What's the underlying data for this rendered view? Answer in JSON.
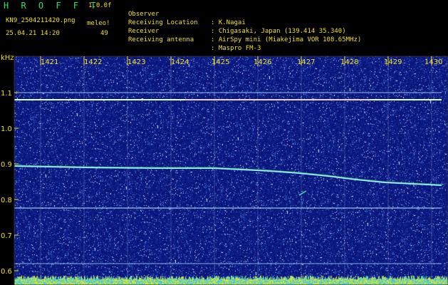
{
  "header": {
    "app_title": "H R O F F T",
    "version": "1.0.0f",
    "filename": "KN9_2504211420.png",
    "datetime": "25.04.21 14:20",
    "station": "meleo!",
    "count": "49"
  },
  "info": [
    {
      "label": "Observer",
      "value": ": K.Nagai"
    },
    {
      "label": "Receiving Location",
      "value": ": Chigasaki, Japan (139.414 35.340)"
    },
    {
      "label": "Receiver",
      "value": ": AirSpy mini (Miakejima VOR 108.65MHz)"
    },
    {
      "label": "Receiving antenna",
      "value": ": Maspro FM-3"
    }
  ],
  "axes": {
    "y_unit": "kHz",
    "y_ticks": [
      "1.1",
      "1.0",
      "0.9",
      "0.8",
      "0.7",
      "0.6"
    ],
    "x_ticks": [
      "1421",
      "1422",
      "1423",
      "1424",
      "1425",
      "1426",
      "1427",
      "1428",
      "1429",
      "1430"
    ]
  },
  "colors": {
    "text": "#f0e020",
    "title": "#2ee06a",
    "background": "#0a1478",
    "carrier": "#b8f0ff",
    "signal": "#9fe8ff",
    "ticks": "#f0e020",
    "baseline": "#d0f040"
  }
}
